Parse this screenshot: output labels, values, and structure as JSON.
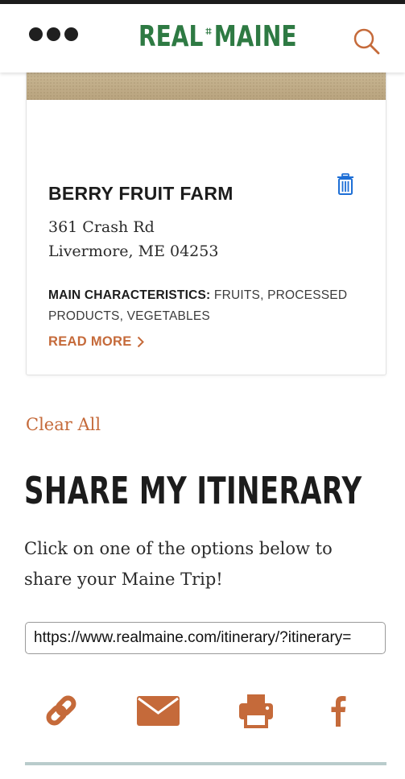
{
  "header": {
    "logo_left": "REAL",
    "logo_mark": "⌗",
    "logo_right": "MAINE",
    "menu_icon": "more-dots-icon",
    "search_icon": "search-icon"
  },
  "card": {
    "name": "BERRY FRUIT FARM",
    "address_line1": "361 Crash Rd",
    "address_line2": "Livermore, ME 04253",
    "characteristics_label": "MAIN CHARACTERISTICS:",
    "characteristics_value": "FRUITS, PROCESSED PRODUCTS, VEGETABLES",
    "read_more": "READ MORE",
    "delete_icon": "trash-icon"
  },
  "clear_all": "Clear All",
  "share": {
    "title": "SHARE MY ITINERARY",
    "description": "Click on one of the options below to share your Maine Trip!",
    "url_value": "https://www.realmaine.com/itinerary/?itinerary=",
    "icons": [
      "link-icon",
      "email-icon",
      "print-icon",
      "facebook-icon"
    ]
  },
  "colors": {
    "brand_green": "#2e7a43",
    "accent_orange": "#c56a3a",
    "dark_text": "#1c1c1c",
    "trash_blue": "#1e6fd6",
    "rule_teal": "#b9cccc"
  }
}
